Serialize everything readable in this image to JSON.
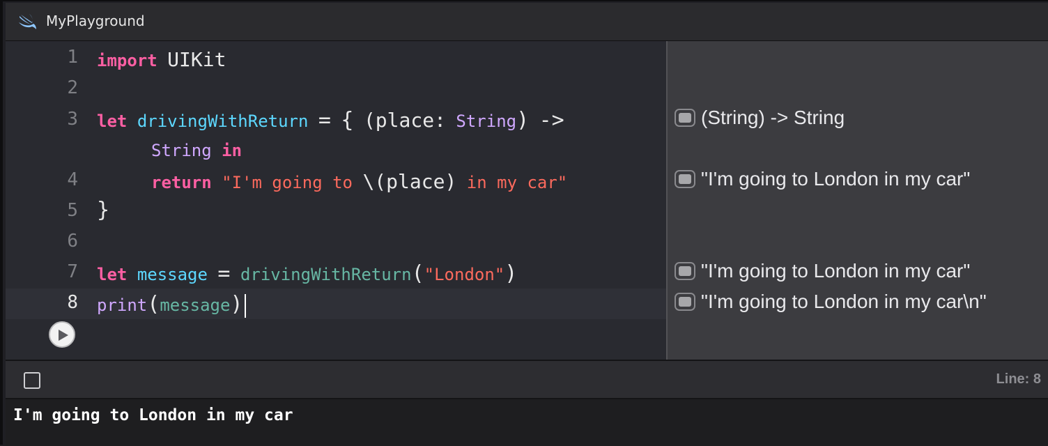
{
  "window": {
    "title": "MyPlayground"
  },
  "editor": {
    "line_numbers": [
      "1",
      "2",
      "3",
      "4",
      "5",
      "6",
      "7",
      "8"
    ],
    "lines": {
      "l1": {
        "kw": "import",
        "rest": "UIKit"
      },
      "l3": {
        "kw": "let",
        "name": "drivingWithReturn",
        "eq": "=",
        "brace": "{",
        "open": "(place:",
        "type": "String",
        "close": ")",
        "arrow": "->"
      },
      "l3b": {
        "type": "String",
        "kw": "in"
      },
      "l4": {
        "kw": "return",
        "str_a": "\"I'm going to",
        "interp": "\\(place)",
        "str_b": "in my car\""
      },
      "l5": {
        "brace": "}"
      },
      "l7": {
        "kw": "let",
        "name": "message",
        "eq": "=",
        "call": "drivingWithReturn",
        "open": "(",
        "arg": "\"London\"",
        "close": ")"
      },
      "l8": {
        "fn": "print",
        "open": "(",
        "arg": "message",
        "close": ")"
      }
    }
  },
  "results": [
    "(String) -> String",
    "\"I'm going to London in my car\"",
    "\"I'm going to London in my car\"",
    "\"I'm going to London in my car\\n\""
  ],
  "status": {
    "line_indicator": "Line: 8"
  },
  "console": {
    "output": "I'm going to London in my car"
  },
  "colors": {
    "keyword": "#fc5fa3",
    "type": "#d0a8ff",
    "declaration": "#5dd8ff",
    "identifier": "#67b7a4",
    "string": "#fc6a5d",
    "editor_bg": "#292a30",
    "results_bg": "#3c3c40"
  },
  "icons": {
    "title": "swift-icon",
    "run": "play-icon",
    "result": "quick-look-toggle-icon",
    "console": "console-toggle-icon"
  }
}
